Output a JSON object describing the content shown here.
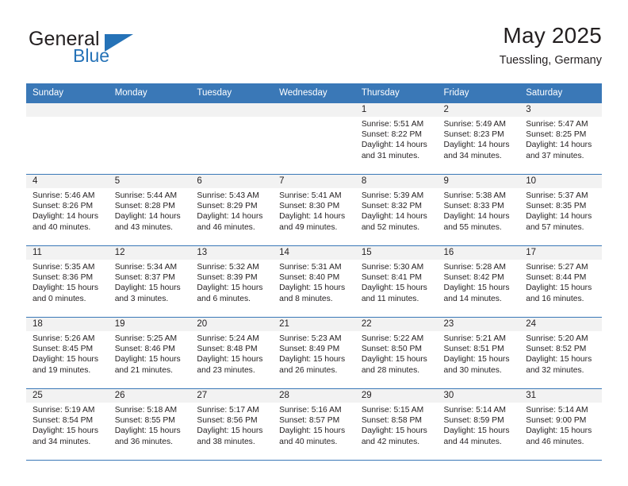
{
  "brand": {
    "word1": "General",
    "word2": "Blue",
    "triangle_color": "#2572b7"
  },
  "header": {
    "title": "May 2025",
    "subtitle": "Tuessling, Germany"
  },
  "theme": {
    "header_blue": "#3a78b7",
    "band_gray": "#f2f2f2",
    "text": "#231f20"
  },
  "weekday_headers": [
    "Sunday",
    "Monday",
    "Tuesday",
    "Wednesday",
    "Thursday",
    "Friday",
    "Saturday"
  ],
  "weeks": [
    [
      {
        "day": "",
        "sunrise": "",
        "sunset": "",
        "daylight1": "",
        "daylight2": ""
      },
      {
        "day": "",
        "sunrise": "",
        "sunset": "",
        "daylight1": "",
        "daylight2": ""
      },
      {
        "day": "",
        "sunrise": "",
        "sunset": "",
        "daylight1": "",
        "daylight2": ""
      },
      {
        "day": "",
        "sunrise": "",
        "sunset": "",
        "daylight1": "",
        "daylight2": ""
      },
      {
        "day": "1",
        "sunrise": "Sunrise: 5:51 AM",
        "sunset": "Sunset: 8:22 PM",
        "daylight1": "Daylight: 14 hours",
        "daylight2": "and 31 minutes."
      },
      {
        "day": "2",
        "sunrise": "Sunrise: 5:49 AM",
        "sunset": "Sunset: 8:23 PM",
        "daylight1": "Daylight: 14 hours",
        "daylight2": "and 34 minutes."
      },
      {
        "day": "3",
        "sunrise": "Sunrise: 5:47 AM",
        "sunset": "Sunset: 8:25 PM",
        "daylight1": "Daylight: 14 hours",
        "daylight2": "and 37 minutes."
      }
    ],
    [
      {
        "day": "4",
        "sunrise": "Sunrise: 5:46 AM",
        "sunset": "Sunset: 8:26 PM",
        "daylight1": "Daylight: 14 hours",
        "daylight2": "and 40 minutes."
      },
      {
        "day": "5",
        "sunrise": "Sunrise: 5:44 AM",
        "sunset": "Sunset: 8:28 PM",
        "daylight1": "Daylight: 14 hours",
        "daylight2": "and 43 minutes."
      },
      {
        "day": "6",
        "sunrise": "Sunrise: 5:43 AM",
        "sunset": "Sunset: 8:29 PM",
        "daylight1": "Daylight: 14 hours",
        "daylight2": "and 46 minutes."
      },
      {
        "day": "7",
        "sunrise": "Sunrise: 5:41 AM",
        "sunset": "Sunset: 8:30 PM",
        "daylight1": "Daylight: 14 hours",
        "daylight2": "and 49 minutes."
      },
      {
        "day": "8",
        "sunrise": "Sunrise: 5:39 AM",
        "sunset": "Sunset: 8:32 PM",
        "daylight1": "Daylight: 14 hours",
        "daylight2": "and 52 minutes."
      },
      {
        "day": "9",
        "sunrise": "Sunrise: 5:38 AM",
        "sunset": "Sunset: 8:33 PM",
        "daylight1": "Daylight: 14 hours",
        "daylight2": "and 55 minutes."
      },
      {
        "day": "10",
        "sunrise": "Sunrise: 5:37 AM",
        "sunset": "Sunset: 8:35 PM",
        "daylight1": "Daylight: 14 hours",
        "daylight2": "and 57 minutes."
      }
    ],
    [
      {
        "day": "11",
        "sunrise": "Sunrise: 5:35 AM",
        "sunset": "Sunset: 8:36 PM",
        "daylight1": "Daylight: 15 hours",
        "daylight2": "and 0 minutes."
      },
      {
        "day": "12",
        "sunrise": "Sunrise: 5:34 AM",
        "sunset": "Sunset: 8:37 PM",
        "daylight1": "Daylight: 15 hours",
        "daylight2": "and 3 minutes."
      },
      {
        "day": "13",
        "sunrise": "Sunrise: 5:32 AM",
        "sunset": "Sunset: 8:39 PM",
        "daylight1": "Daylight: 15 hours",
        "daylight2": "and 6 minutes."
      },
      {
        "day": "14",
        "sunrise": "Sunrise: 5:31 AM",
        "sunset": "Sunset: 8:40 PM",
        "daylight1": "Daylight: 15 hours",
        "daylight2": "and 8 minutes."
      },
      {
        "day": "15",
        "sunrise": "Sunrise: 5:30 AM",
        "sunset": "Sunset: 8:41 PM",
        "daylight1": "Daylight: 15 hours",
        "daylight2": "and 11 minutes."
      },
      {
        "day": "16",
        "sunrise": "Sunrise: 5:28 AM",
        "sunset": "Sunset: 8:42 PM",
        "daylight1": "Daylight: 15 hours",
        "daylight2": "and 14 minutes."
      },
      {
        "day": "17",
        "sunrise": "Sunrise: 5:27 AM",
        "sunset": "Sunset: 8:44 PM",
        "daylight1": "Daylight: 15 hours",
        "daylight2": "and 16 minutes."
      }
    ],
    [
      {
        "day": "18",
        "sunrise": "Sunrise: 5:26 AM",
        "sunset": "Sunset: 8:45 PM",
        "daylight1": "Daylight: 15 hours",
        "daylight2": "and 19 minutes."
      },
      {
        "day": "19",
        "sunrise": "Sunrise: 5:25 AM",
        "sunset": "Sunset: 8:46 PM",
        "daylight1": "Daylight: 15 hours",
        "daylight2": "and 21 minutes."
      },
      {
        "day": "20",
        "sunrise": "Sunrise: 5:24 AM",
        "sunset": "Sunset: 8:48 PM",
        "daylight1": "Daylight: 15 hours",
        "daylight2": "and 23 minutes."
      },
      {
        "day": "21",
        "sunrise": "Sunrise: 5:23 AM",
        "sunset": "Sunset: 8:49 PM",
        "daylight1": "Daylight: 15 hours",
        "daylight2": "and 26 minutes."
      },
      {
        "day": "22",
        "sunrise": "Sunrise: 5:22 AM",
        "sunset": "Sunset: 8:50 PM",
        "daylight1": "Daylight: 15 hours",
        "daylight2": "and 28 minutes."
      },
      {
        "day": "23",
        "sunrise": "Sunrise: 5:21 AM",
        "sunset": "Sunset: 8:51 PM",
        "daylight1": "Daylight: 15 hours",
        "daylight2": "and 30 minutes."
      },
      {
        "day": "24",
        "sunrise": "Sunrise: 5:20 AM",
        "sunset": "Sunset: 8:52 PM",
        "daylight1": "Daylight: 15 hours",
        "daylight2": "and 32 minutes."
      }
    ],
    [
      {
        "day": "25",
        "sunrise": "Sunrise: 5:19 AM",
        "sunset": "Sunset: 8:54 PM",
        "daylight1": "Daylight: 15 hours",
        "daylight2": "and 34 minutes."
      },
      {
        "day": "26",
        "sunrise": "Sunrise: 5:18 AM",
        "sunset": "Sunset: 8:55 PM",
        "daylight1": "Daylight: 15 hours",
        "daylight2": "and 36 minutes."
      },
      {
        "day": "27",
        "sunrise": "Sunrise: 5:17 AM",
        "sunset": "Sunset: 8:56 PM",
        "daylight1": "Daylight: 15 hours",
        "daylight2": "and 38 minutes."
      },
      {
        "day": "28",
        "sunrise": "Sunrise: 5:16 AM",
        "sunset": "Sunset: 8:57 PM",
        "daylight1": "Daylight: 15 hours",
        "daylight2": "and 40 minutes."
      },
      {
        "day": "29",
        "sunrise": "Sunrise: 5:15 AM",
        "sunset": "Sunset: 8:58 PM",
        "daylight1": "Daylight: 15 hours",
        "daylight2": "and 42 minutes."
      },
      {
        "day": "30",
        "sunrise": "Sunrise: 5:14 AM",
        "sunset": "Sunset: 8:59 PM",
        "daylight1": "Daylight: 15 hours",
        "daylight2": "and 44 minutes."
      },
      {
        "day": "31",
        "sunrise": "Sunrise: 5:14 AM",
        "sunset": "Sunset: 9:00 PM",
        "daylight1": "Daylight: 15 hours",
        "daylight2": "and 46 minutes."
      }
    ]
  ]
}
